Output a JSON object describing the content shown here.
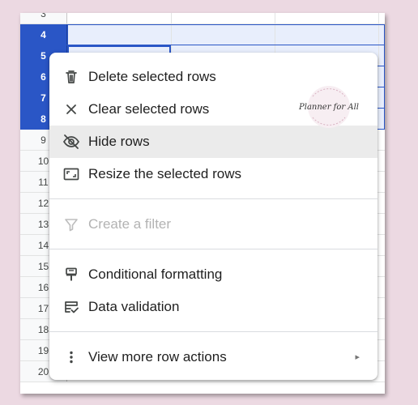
{
  "sheet": {
    "top_row_partial": "3",
    "rows": [
      "4",
      "5",
      "6",
      "7",
      "8",
      "9",
      "10",
      "11",
      "12",
      "13",
      "14",
      "15",
      "16",
      "17",
      "18",
      "19",
      "20"
    ],
    "selected_rows": [
      "4",
      "5",
      "6",
      "7",
      "8"
    ]
  },
  "menu": {
    "items": [
      {
        "label": "Delete selected rows",
        "icon": "trash-icon"
      },
      {
        "label": "Clear selected rows",
        "icon": "close-icon"
      },
      {
        "label": "Hide rows",
        "icon": "eye-off-icon"
      },
      {
        "label": "Resize the selected rows",
        "icon": "resize-icon"
      },
      {
        "label": "Create a filter",
        "icon": "filter-icon"
      },
      {
        "label": "Conditional formatting",
        "icon": "paint-format-icon"
      },
      {
        "label": "Data validation",
        "icon": "data-validation-icon"
      },
      {
        "label": "View more row actions",
        "icon": "more-vert-icon"
      }
    ],
    "submenu_arrow": "▸"
  },
  "watermark": {
    "text": "Planner for All",
    "icon": "planner-logo-icon",
    "colors": {
      "accent": "#c98fa5"
    }
  },
  "colors": {
    "page_background": "#ecd9e2",
    "selection": "#2a56c6"
  }
}
